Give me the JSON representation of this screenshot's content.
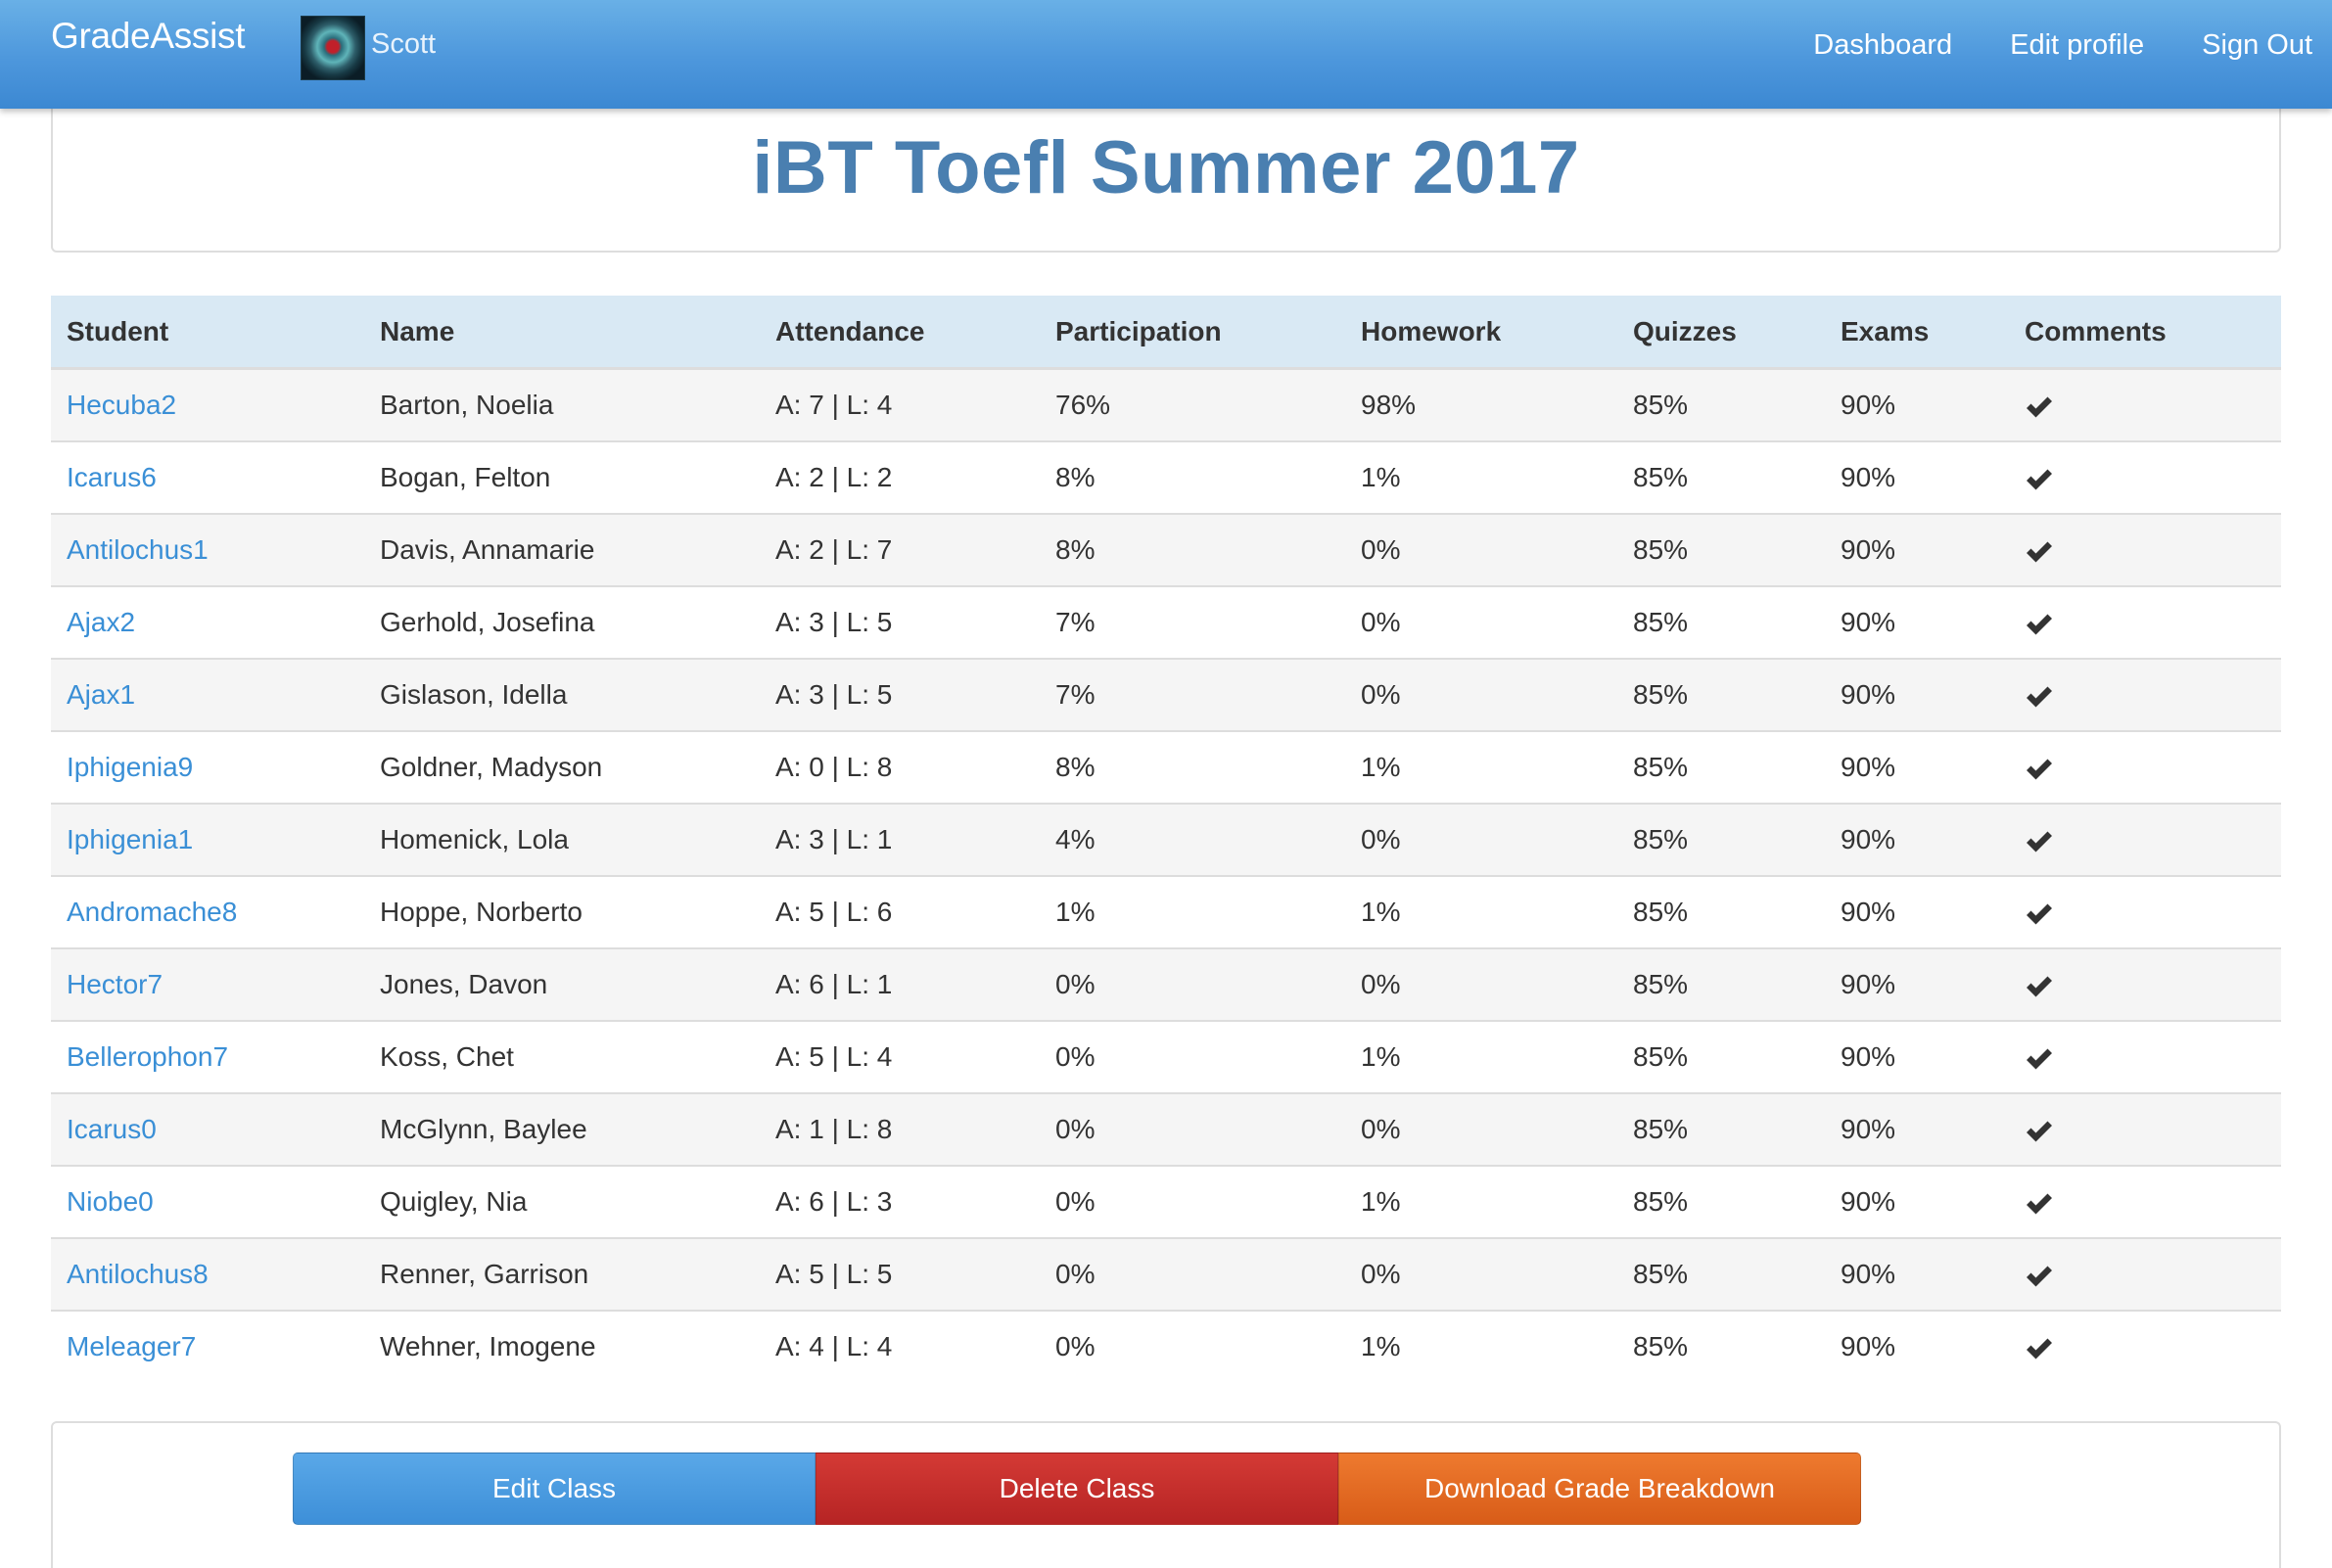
{
  "navbar": {
    "brand": "GradeAssist",
    "user_name": "Scott",
    "links": [
      "Dashboard",
      "Edit profile",
      "Sign Out"
    ]
  },
  "page": {
    "title": "iBT Toefl Summer 2017"
  },
  "table": {
    "headers": [
      "Student",
      "Name",
      "Attendance",
      "Participation",
      "Homework",
      "Quizzes",
      "Exams",
      "Comments"
    ],
    "rows": [
      {
        "student": "Hecuba2",
        "name": "Barton, Noelia",
        "attendance": "A: 7 | L: 4",
        "participation": "76%",
        "homework": "98%",
        "quizzes": "85%",
        "exams": "90%",
        "comments_icon": "check-icon"
      },
      {
        "student": "Icarus6",
        "name": "Bogan, Felton",
        "attendance": "A: 2 | L: 2",
        "participation": "8%",
        "homework": "1%",
        "quizzes": "85%",
        "exams": "90%",
        "comments_icon": "check-icon"
      },
      {
        "student": "Antilochus1",
        "name": "Davis, Annamarie",
        "attendance": "A: 2 | L: 7",
        "participation": "8%",
        "homework": "0%",
        "quizzes": "85%",
        "exams": "90%",
        "comments_icon": "check-icon"
      },
      {
        "student": "Ajax2",
        "name": "Gerhold, Josefina",
        "attendance": "A: 3 | L: 5",
        "participation": "7%",
        "homework": "0%",
        "quizzes": "85%",
        "exams": "90%",
        "comments_icon": "check-icon"
      },
      {
        "student": "Ajax1",
        "name": "Gislason, Idella",
        "attendance": "A: 3 | L: 5",
        "participation": "7%",
        "homework": "0%",
        "quizzes": "85%",
        "exams": "90%",
        "comments_icon": "check-icon"
      },
      {
        "student": "Iphigenia9",
        "name": "Goldner, Madyson",
        "attendance": "A: 0 | L: 8",
        "participation": "8%",
        "homework": "1%",
        "quizzes": "85%",
        "exams": "90%",
        "comments_icon": "check-icon"
      },
      {
        "student": "Iphigenia1",
        "name": "Homenick, Lola",
        "attendance": "A: 3 | L: 1",
        "participation": "4%",
        "homework": "0%",
        "quizzes": "85%",
        "exams": "90%",
        "comments_icon": "check-icon"
      },
      {
        "student": "Andromache8",
        "name": "Hoppe, Norberto",
        "attendance": "A: 5 | L: 6",
        "participation": "1%",
        "homework": "1%",
        "quizzes": "85%",
        "exams": "90%",
        "comments_icon": "check-icon"
      },
      {
        "student": "Hector7",
        "name": "Jones, Davon",
        "attendance": "A: 6 | L: 1",
        "participation": "0%",
        "homework": "0%",
        "quizzes": "85%",
        "exams": "90%",
        "comments_icon": "check-icon"
      },
      {
        "student": "Bellerophon7",
        "name": "Koss, Chet",
        "attendance": "A: 5 | L: 4",
        "participation": "0%",
        "homework": "1%",
        "quizzes": "85%",
        "exams": "90%",
        "comments_icon": "check-icon"
      },
      {
        "student": "Icarus0",
        "name": "McGlynn, Baylee",
        "attendance": "A: 1 | L: 8",
        "participation": "0%",
        "homework": "0%",
        "quizzes": "85%",
        "exams": "90%",
        "comments_icon": "check-icon"
      },
      {
        "student": "Niobe0",
        "name": "Quigley, Nia",
        "attendance": "A: 6 | L: 3",
        "participation": "0%",
        "homework": "1%",
        "quizzes": "85%",
        "exams": "90%",
        "comments_icon": "check-icon"
      },
      {
        "student": "Antilochus8",
        "name": "Renner, Garrison",
        "attendance": "A: 5 | L: 5",
        "participation": "0%",
        "homework": "0%",
        "quizzes": "85%",
        "exams": "90%",
        "comments_icon": "check-icon"
      },
      {
        "student": "Meleager7",
        "name": "Wehner, Imogene",
        "attendance": "A: 4 | L: 4",
        "participation": "0%",
        "homework": "1%",
        "quizzes": "85%",
        "exams": "90%",
        "comments_icon": "check-icon"
      }
    ]
  },
  "actions": {
    "edit_label": "Edit Class",
    "delete_label": "Delete Class",
    "download_label": "Download Grade Breakdown"
  },
  "colors": {
    "navbar": "#4d97dc",
    "title": "#4a7fb0",
    "link": "#3a8fd6",
    "header_bg": "#d9e9f4",
    "edit_button": "#3d8fd8",
    "delete_button": "#b62424",
    "download_button": "#d85c18"
  }
}
